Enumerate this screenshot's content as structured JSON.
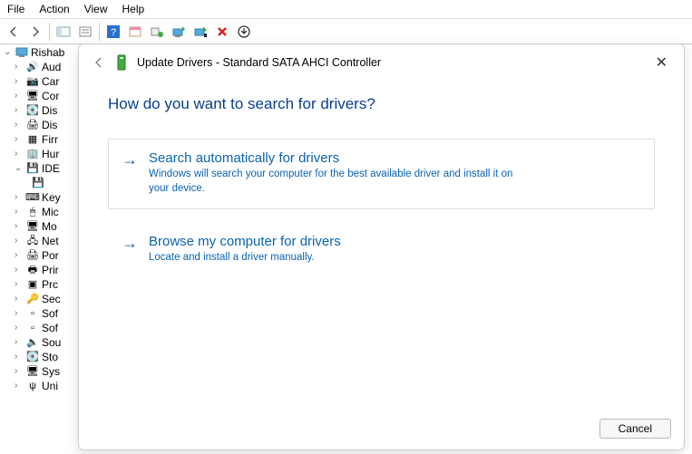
{
  "menu": {
    "items": [
      "File",
      "Action",
      "View",
      "Help"
    ]
  },
  "tree": {
    "root": "Rishab",
    "nodes": [
      {
        "label": "Aud",
        "icon": "speaker",
        "exp": ">"
      },
      {
        "label": "Car",
        "icon": "camera",
        "exp": ">"
      },
      {
        "label": "Cor",
        "icon": "monitor",
        "exp": ">"
      },
      {
        "label": "Dis",
        "icon": "disk",
        "exp": ">"
      },
      {
        "label": "Dis",
        "icon": "display",
        "exp": ">"
      },
      {
        "label": "Firr",
        "icon": "chip",
        "exp": ">"
      },
      {
        "label": "Hur",
        "icon": "building",
        "exp": ">"
      },
      {
        "label": "IDE",
        "icon": "ide",
        "exp": "v"
      },
      {
        "label": "Key",
        "icon": "keyboard",
        "exp": ">"
      },
      {
        "label": "Mic",
        "icon": "mouse",
        "exp": ">"
      },
      {
        "label": "Mo",
        "icon": "monitor",
        "exp": ">"
      },
      {
        "label": "Net",
        "icon": "net",
        "exp": ">"
      },
      {
        "label": "Por",
        "icon": "printer",
        "exp": ">"
      },
      {
        "label": "Prir",
        "icon": "printq",
        "exp": ">"
      },
      {
        "label": "Prc",
        "icon": "cpu",
        "exp": ">"
      },
      {
        "label": "Sec",
        "icon": "security",
        "exp": ">"
      },
      {
        "label": "Sof",
        "icon": "soft",
        "exp": ">"
      },
      {
        "label": "Sof",
        "icon": "soft",
        "exp": ">"
      },
      {
        "label": "Sou",
        "icon": "sound",
        "exp": ">"
      },
      {
        "label": "Sto",
        "icon": "storage",
        "exp": ">"
      },
      {
        "label": "Sys",
        "icon": "sys",
        "exp": ">"
      },
      {
        "label": "Uni",
        "icon": "usb",
        "exp": ">"
      }
    ],
    "ide_child_icon": "ide-controller"
  },
  "dialog": {
    "back_icon": "back-arrow",
    "title_icon": "device-disk",
    "title": "Update Drivers - Standard SATA AHCI Controller",
    "question": "How do you want to search for drivers?",
    "options": [
      {
        "title": "Search automatically for drivers",
        "desc": "Windows will search your computer for the best available driver and install it on your device."
      },
      {
        "title": "Browse my computer for drivers",
        "desc": "Locate and install a driver manually."
      }
    ],
    "cancel": "Cancel",
    "close": "✕"
  }
}
